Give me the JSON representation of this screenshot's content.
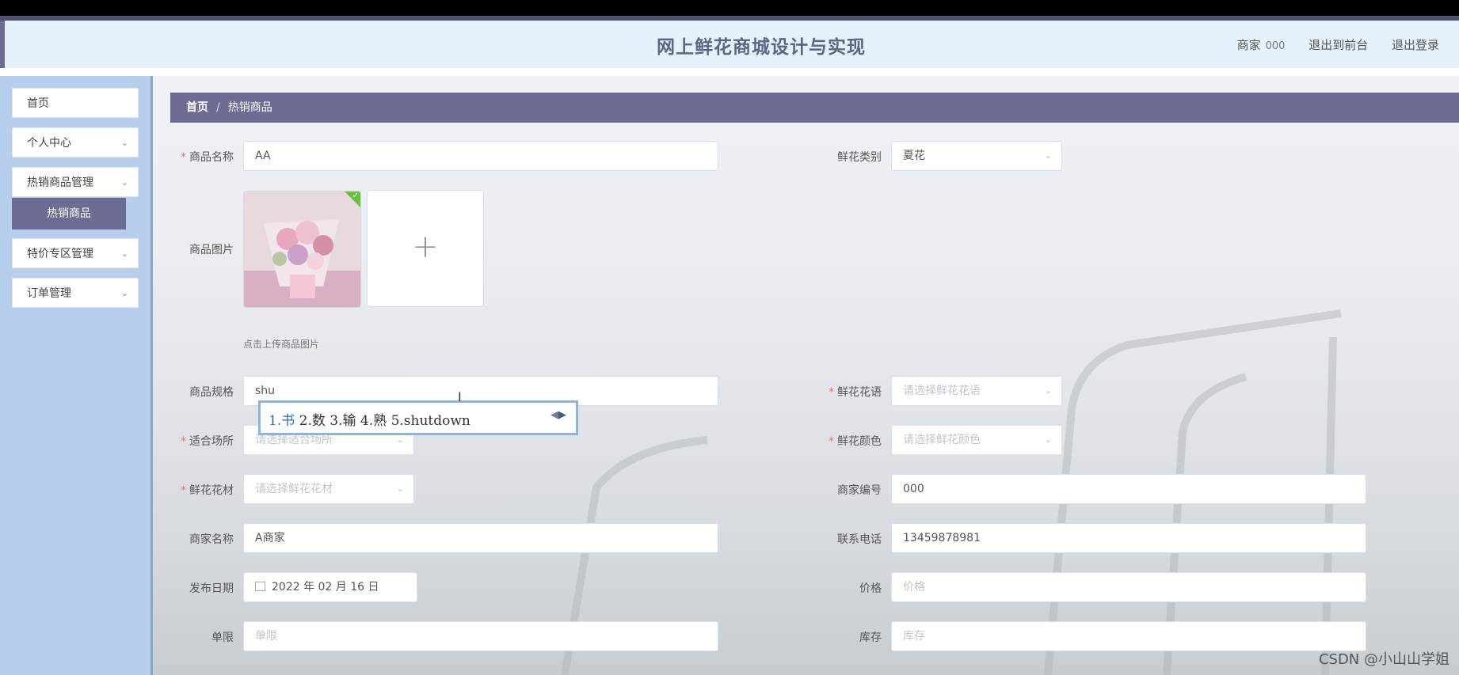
{
  "header": {
    "title": "网上鲜花商城设计与实现",
    "role": "商家",
    "username": "000",
    "front_link": "退出到前台",
    "logout_link": "退出登录"
  },
  "sidebar": {
    "items": [
      {
        "label": "首页"
      },
      {
        "label": "个人中心"
      },
      {
        "label": "热销商品管理"
      },
      {
        "label": "特价专区管理"
      },
      {
        "label": "订单管理"
      }
    ],
    "active_sub": "热销商品"
  },
  "breadcrumb": {
    "home": "首页",
    "sep": "/",
    "current": "热销商品"
  },
  "form": {
    "name": {
      "label": "商品名称",
      "value": "AA"
    },
    "category": {
      "label": "鲜花类别",
      "value": "夏花"
    },
    "image": {
      "label": "商品图片",
      "hint": "点击上传商品图片",
      "add_icon": "+"
    },
    "spec": {
      "label": "商品规格",
      "value": "shu"
    },
    "language": {
      "label": "鲜花花语",
      "placeholder": "请选择鲜花花语"
    },
    "occasion": {
      "label": "适合场所",
      "placeholder": "请选择适合场所"
    },
    "color": {
      "label": "鲜花颜色",
      "placeholder": "请选择鲜花颜色"
    },
    "material": {
      "label": "鲜花花材",
      "placeholder": "请选择鲜花花材"
    },
    "merchant_id": {
      "label": "商家编号",
      "value": "000"
    },
    "merchant_name": {
      "label": "商家名称",
      "value": "A商家"
    },
    "phone": {
      "label": "联系电话",
      "value": "13459878981"
    },
    "publish_date": {
      "label": "发布日期",
      "value": "2022 年 02 月 16 日"
    },
    "price": {
      "label": "价格",
      "placeholder": "价格"
    },
    "limit": {
      "label": "单限",
      "placeholder": "单限"
    },
    "stock": {
      "label": "库存",
      "placeholder": "库存"
    }
  },
  "ime": {
    "candidates": [
      "1.书",
      "2.数",
      "3.输",
      "4.熟",
      "5.shutdown"
    ]
  },
  "watermark": "CSDN @小山山学姐",
  "icons": {
    "chevron": "chevron-down-icon",
    "calendar": "calendar-icon",
    "check": "check-icon"
  }
}
